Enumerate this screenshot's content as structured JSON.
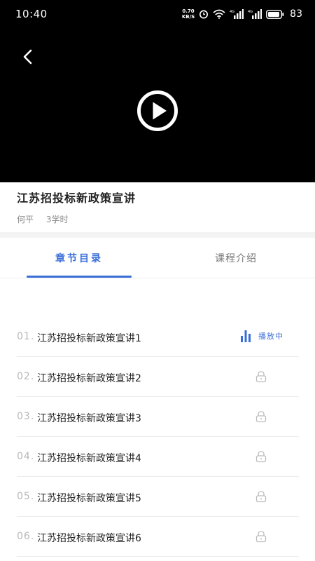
{
  "status_bar": {
    "time": "10:40",
    "net_speed_value": "0.70",
    "net_speed_unit": "KB/S",
    "signal_1_label": "4G",
    "signal_2_label": "4G",
    "battery": "83"
  },
  "player": {
    "back_icon": "chevron-left-icon",
    "play_icon": "play-circle-icon"
  },
  "course": {
    "title": "江苏招投标新政策宣讲",
    "teacher": "何平",
    "hours": "3学时"
  },
  "tabs": [
    {
      "label": "章节目录",
      "active": true
    },
    {
      "label": "课程介绍",
      "active": false
    }
  ],
  "chapters": [
    {
      "num": "01.",
      "title": "江苏招投标新政策宣讲1",
      "status": "播放中"
    },
    {
      "num": "02.",
      "title": "江苏招投标新政策宣讲2",
      "status": "locked"
    },
    {
      "num": "03.",
      "title": "江苏招投标新政策宣讲3",
      "status": "locked"
    },
    {
      "num": "04.",
      "title": "江苏招投标新政策宣讲4",
      "status": "locked"
    },
    {
      "num": "05.",
      "title": "江苏招投标新政策宣讲5",
      "status": "locked"
    },
    {
      "num": "06.",
      "title": "江苏招投标新政策宣讲6",
      "status": "locked"
    }
  ],
  "colors": {
    "accent": "#3a6fd8",
    "video_bg": "#000000",
    "muted_text": "#8c8c8c"
  }
}
